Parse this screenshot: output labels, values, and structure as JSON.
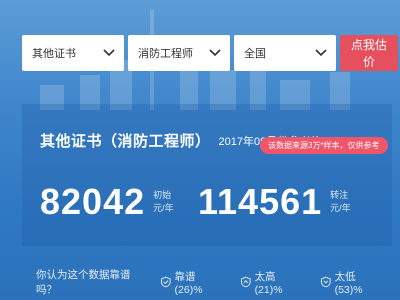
{
  "filters": {
    "category": "其他证书",
    "certificate": "消防工程师",
    "region": "全国"
  },
  "estimate_button": "点我估价",
  "card": {
    "title": "其他证书（消防工程师）",
    "reference": "2017年09月份参考价",
    "note": "该数据来源3万*样本，仅供参考"
  },
  "salaries": {
    "entry": {
      "amount": "82042",
      "label": "初始",
      "unit": "元/年"
    },
    "senior": {
      "amount": "114561",
      "label": "转注",
      "unit": "元/年"
    }
  },
  "poll": {
    "question": "你认为这个数据靠谱吗？",
    "options": [
      "靠谱(26)%",
      "太高(21)%",
      "太低(53)%"
    ]
  }
}
